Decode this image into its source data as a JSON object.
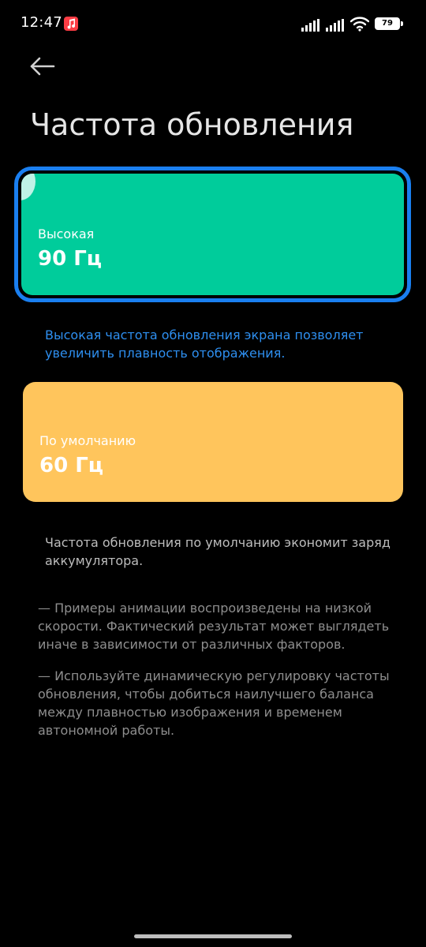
{
  "status_bar": {
    "time": "12:47",
    "battery": "79"
  },
  "header": {
    "title": "Частота обновления"
  },
  "options": {
    "high": {
      "label": "Высокая",
      "value": "90 Гц",
      "description": "Высокая частота обновления экрана позволяет увеличить плавность отображения.",
      "selected": true,
      "color": "#00cc9b"
    },
    "default": {
      "label": "По умолчанию",
      "value": "60 Гц",
      "description": "Частота обновления по умолчанию экономит заряд аккумулятора.",
      "selected": false,
      "color": "#ffc55c"
    }
  },
  "notes": [
    "— Примеры анимации воспроизведены на низкой скорости. Фактический результат может выглядеть иначе в зависимости от различных факторов.",
    "— Используйте динамическую регулировку частоты обновления, чтобы добиться наилучшего баланса между плавностью изображения и временем автономной работы."
  ],
  "colors": {
    "accent": "#1a7ff0",
    "description_accent": "#2e8ff0",
    "background": "#000000"
  },
  "icons": {
    "back": "back-arrow-icon",
    "music": "music-app-icon",
    "signal": "cellular-signal-icon",
    "wifi": "wifi-icon",
    "battery": "battery-icon"
  }
}
